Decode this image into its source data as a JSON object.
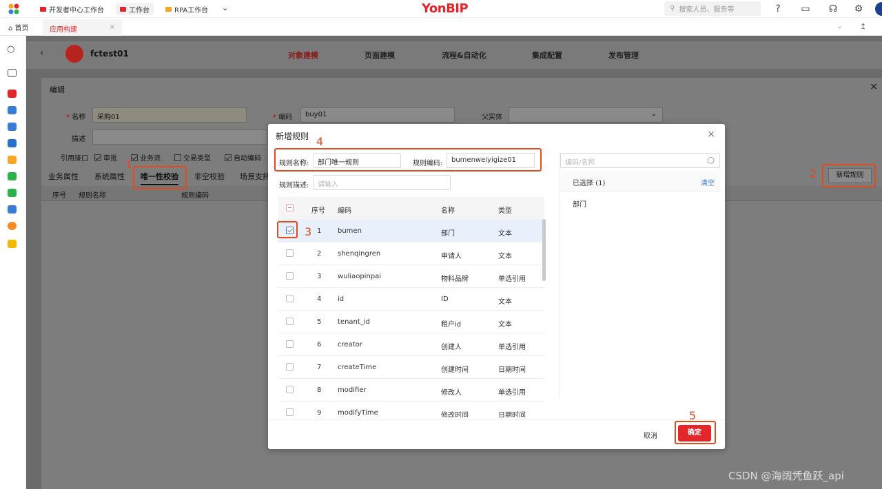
{
  "topbar": {
    "tabs": [
      "开发者中心工作台",
      "工作台",
      "RPA工作台"
    ],
    "brand": "YonBIP",
    "search_placeholder": "搜索人员、服务等"
  },
  "tabbar": {
    "home": "首页",
    "app_tab": "应用构建"
  },
  "app": {
    "name": "fctest01",
    "nav": [
      "对象建模",
      "页面建模",
      "流程&自动化",
      "集成配置",
      "发布管理"
    ]
  },
  "edit_panel": {
    "title": "编辑",
    "name_label": "名称",
    "name_value": "采购01",
    "code_label": "编码",
    "code_value": "buy01",
    "parent_label": "父实体",
    "desc_label": "描述",
    "ref_label": "引用接口",
    "ref_options": [
      {
        "label": "审批",
        "checked": true
      },
      {
        "label": "业务流",
        "checked": true
      },
      {
        "label": "交易类型",
        "checked": false
      },
      {
        "label": "自动编码",
        "checked": true
      }
    ],
    "subtabs": [
      "业务属性",
      "系统属性",
      "唯一性校验",
      "非空校验",
      "场景支持"
    ],
    "table_headers": [
      "序号",
      "规则名称",
      "规则编码"
    ],
    "new_rule_button": "新增规则"
  },
  "modal": {
    "title": "新增规则",
    "rule_name_label": "规则名称:",
    "rule_name_value": "部门唯一规则",
    "rule_code_label": "规则编码:",
    "rule_code_value": "bumenweiyigize01",
    "rule_desc_label": "规则描述:",
    "rule_desc_placeholder": "请输入",
    "grid_headers": [
      "序号",
      "编码",
      "名称",
      "类型"
    ],
    "rows": [
      {
        "no": "1",
        "code": "bumen",
        "name": "部门",
        "type": "文本"
      },
      {
        "no": "2",
        "code": "shenqingren",
        "name": "申请人",
        "type": "文本"
      },
      {
        "no": "3",
        "code": "wuliaopinpai",
        "name": "物料品牌",
        "type": "单选引用"
      },
      {
        "no": "4",
        "code": "id",
        "name": "ID",
        "type": "文本"
      },
      {
        "no": "5",
        "code": "tenant_id",
        "name": "租户id",
        "type": "文本"
      },
      {
        "no": "6",
        "code": "creator",
        "name": "创建人",
        "type": "单选引用"
      },
      {
        "no": "7",
        "code": "createTime",
        "name": "创建时间",
        "type": "日期时间"
      },
      {
        "no": "8",
        "code": "modifier",
        "name": "修改人",
        "type": "单选引用"
      },
      {
        "no": "9",
        "code": "modifyTime",
        "name": "修改时间",
        "type": "日期时间"
      }
    ],
    "right_search_placeholder": "编码/名称",
    "selected_label": "已选择 (1)",
    "clear_label": "清空",
    "selected_items": [
      "部门"
    ],
    "cancel": "取消",
    "confirm": "确定"
  },
  "callouts": [
    "1",
    "2",
    "3",
    "4",
    "5"
  ],
  "watermark": "CSDN @海阔凭鱼跃_api",
  "colors": {
    "brand": "#e3262a",
    "callout": "#e24b1c",
    "link": "#3a7bd5"
  }
}
